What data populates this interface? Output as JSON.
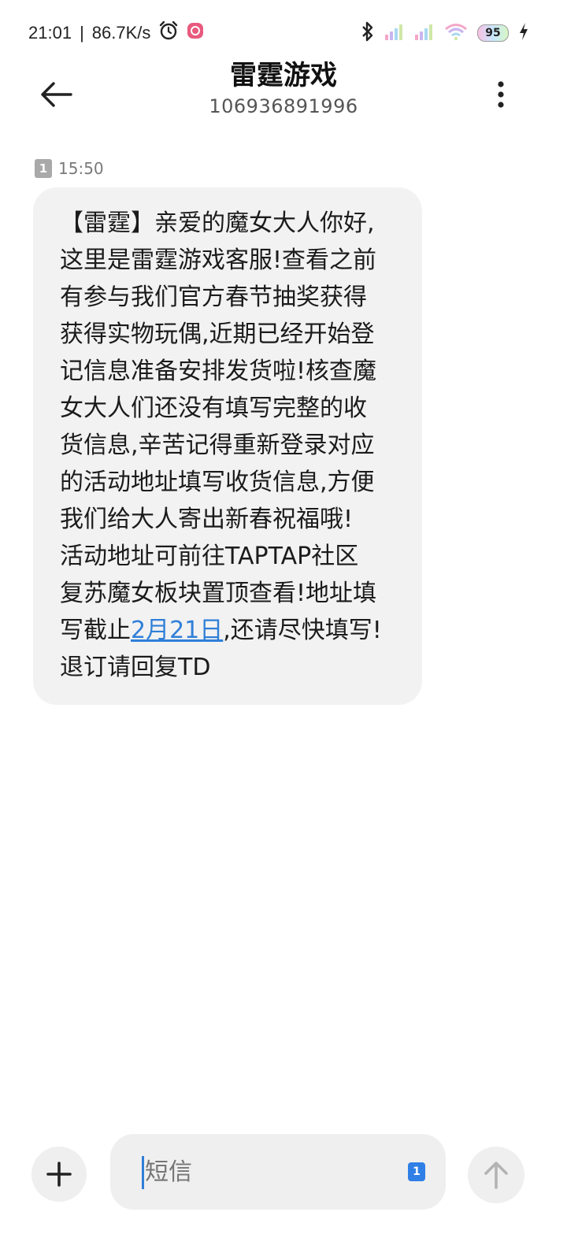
{
  "status_bar": {
    "time": "21:01",
    "separator": "|",
    "network_speed": "86.7K/s",
    "battery_level": "95",
    "icons": [
      "alarm-icon",
      "app-notification-icon",
      "bluetooth-icon",
      "signal-icon",
      "signal-icon",
      "wifi-icon",
      "battery-icon",
      "charging-icon"
    ]
  },
  "header": {
    "title": "雷霆游戏",
    "phone_number": "106936891996",
    "back_icon": "arrow-left-icon",
    "more_icon": "more-vertical-icon"
  },
  "message": {
    "sim_slot": "1",
    "time": "15:50",
    "lines": [
      "【雷霆】亲爱的魔女大人你好,",
      "这里是雷霆游戏客服!查看之前",
      "有参与我们官方春节抽奖获得",
      "获得实物玩偶,近期已经开始登",
      "记信息准备安排发货啦!核查魔",
      "女大人们还没有填写完整的收",
      "货信息,辛苦记得重新登录对应",
      "的活动地址填写收货信息,方便",
      "我们给大人寄出新春祝福哦!",
      "活动地址可前往TAPTAP社区",
      "复苏魔女板块置顶查看!地址填"
    ],
    "line12_prefix": "写截止",
    "line12_link": "2月21日",
    "line12_suffix": ",还请尽快填写!",
    "last_line": "退订请回复TD"
  },
  "composer": {
    "placeholder": "短信",
    "sim_slot": "1",
    "add_icon": "plus-icon",
    "send_icon": "arrow-up-icon"
  },
  "colors": {
    "bubble": "#f2f2f2",
    "link": "#2f7fd8",
    "accent": "#2f7fe6"
  }
}
